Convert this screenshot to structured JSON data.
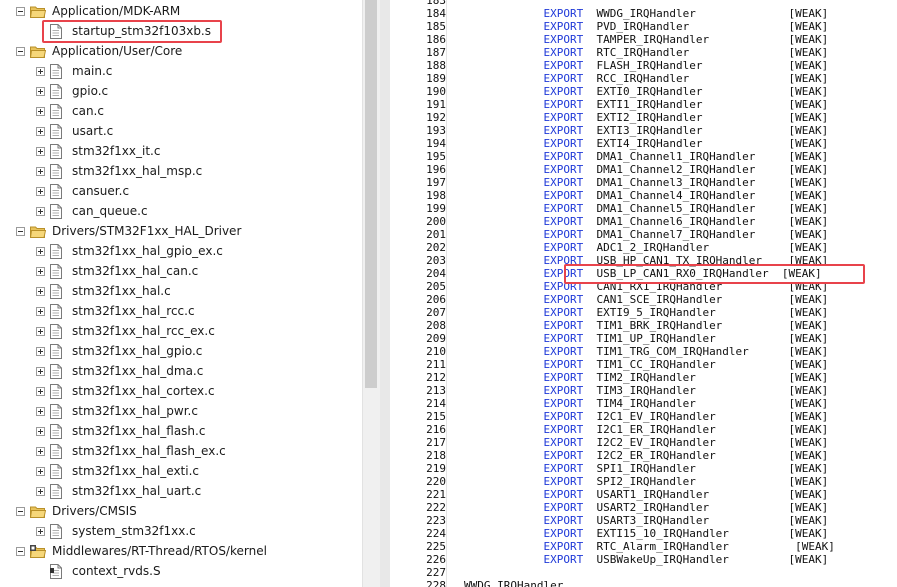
{
  "tree": {
    "items": [
      {
        "kind": "folder",
        "level": 0,
        "expander": "minus",
        "label": "Application/MDK-ARM"
      },
      {
        "kind": "file",
        "level": 1,
        "expander": "none",
        "label": "startup_stm32f103xb.s"
      },
      {
        "kind": "folder",
        "level": 0,
        "expander": "minus",
        "label": "Application/User/Core"
      },
      {
        "kind": "file",
        "level": 1,
        "expander": "plus",
        "label": "main.c"
      },
      {
        "kind": "file",
        "level": 1,
        "expander": "plus",
        "label": "gpio.c"
      },
      {
        "kind": "file",
        "level": 1,
        "expander": "plus",
        "label": "can.c"
      },
      {
        "kind": "file",
        "level": 1,
        "expander": "plus",
        "label": "usart.c"
      },
      {
        "kind": "file",
        "level": 1,
        "expander": "plus",
        "label": "stm32f1xx_it.c"
      },
      {
        "kind": "file",
        "level": 1,
        "expander": "plus",
        "label": "stm32f1xx_hal_msp.c"
      },
      {
        "kind": "file",
        "level": 1,
        "expander": "plus",
        "label": "cansuer.c"
      },
      {
        "kind": "file",
        "level": 1,
        "expander": "plus",
        "label": "can_queue.c"
      },
      {
        "kind": "folder",
        "level": 0,
        "expander": "minus",
        "label": "Drivers/STM32F1xx_HAL_Driver"
      },
      {
        "kind": "file",
        "level": 1,
        "expander": "plus",
        "label": "stm32f1xx_hal_gpio_ex.c"
      },
      {
        "kind": "file",
        "level": 1,
        "expander": "plus",
        "label": "stm32f1xx_hal_can.c"
      },
      {
        "kind": "file",
        "level": 1,
        "expander": "plus",
        "label": "stm32f1xx_hal.c"
      },
      {
        "kind": "file",
        "level": 1,
        "expander": "plus",
        "label": "stm32f1xx_hal_rcc.c"
      },
      {
        "kind": "file",
        "level": 1,
        "expander": "plus",
        "label": "stm32f1xx_hal_rcc_ex.c"
      },
      {
        "kind": "file",
        "level": 1,
        "expander": "plus",
        "label": "stm32f1xx_hal_gpio.c"
      },
      {
        "kind": "file",
        "level": 1,
        "expander": "plus",
        "label": "stm32f1xx_hal_dma.c"
      },
      {
        "kind": "file",
        "level": 1,
        "expander": "plus",
        "label": "stm32f1xx_hal_cortex.c"
      },
      {
        "kind": "file",
        "level": 1,
        "expander": "plus",
        "label": "stm32f1xx_hal_pwr.c"
      },
      {
        "kind": "file",
        "level": 1,
        "expander": "plus",
        "label": "stm32f1xx_hal_flash.c"
      },
      {
        "kind": "file",
        "level": 1,
        "expander": "plus",
        "label": "stm32f1xx_hal_flash_ex.c"
      },
      {
        "kind": "file",
        "level": 1,
        "expander": "plus",
        "label": "stm32f1xx_hal_exti.c"
      },
      {
        "kind": "file",
        "level": 1,
        "expander": "plus",
        "label": "stm32f1xx_hal_uart.c"
      },
      {
        "kind": "folder",
        "level": 0,
        "expander": "minus",
        "label": "Drivers/CMSIS"
      },
      {
        "kind": "file",
        "level": 1,
        "expander": "plus",
        "label": "system_stm32f1xx.c"
      },
      {
        "kind": "folder-special",
        "level": 0,
        "expander": "minus",
        "label": "Middlewares/RT-Thread/RTOS/kernel"
      },
      {
        "kind": "file-special",
        "level": 1,
        "expander": "none",
        "label": "context_rvds.S"
      }
    ]
  },
  "code": {
    "lines": [
      {
        "n": "183",
        "kw": "",
        "text": ""
      },
      {
        "n": "184",
        "kw": "EXPORT",
        "text": "  WWDG_IRQHandler              [WEAK]"
      },
      {
        "n": "185",
        "kw": "EXPORT",
        "text": "  PVD_IRQHandler               [WEAK]"
      },
      {
        "n": "186",
        "kw": "EXPORT",
        "text": "  TAMPER_IRQHandler            [WEAK]"
      },
      {
        "n": "187",
        "kw": "EXPORT",
        "text": "  RTC_IRQHandler               [WEAK]"
      },
      {
        "n": "188",
        "kw": "EXPORT",
        "text": "  FLASH_IRQHandler             [WEAK]"
      },
      {
        "n": "189",
        "kw": "EXPORT",
        "text": "  RCC_IRQHandler               [WEAK]"
      },
      {
        "n": "190",
        "kw": "EXPORT",
        "text": "  EXTI0_IRQHandler             [WEAK]"
      },
      {
        "n": "191",
        "kw": "EXPORT",
        "text": "  EXTI1_IRQHandler             [WEAK]"
      },
      {
        "n": "192",
        "kw": "EXPORT",
        "text": "  EXTI2_IRQHandler             [WEAK]"
      },
      {
        "n": "193",
        "kw": "EXPORT",
        "text": "  EXTI3_IRQHandler             [WEAK]"
      },
      {
        "n": "194",
        "kw": "EXPORT",
        "text": "  EXTI4_IRQHandler             [WEAK]"
      },
      {
        "n": "195",
        "kw": "EXPORT",
        "text": "  DMA1_Channel1_IRQHandler     [WEAK]"
      },
      {
        "n": "196",
        "kw": "EXPORT",
        "text": "  DMA1_Channel2_IRQHandler     [WEAK]"
      },
      {
        "n": "197",
        "kw": "EXPORT",
        "text": "  DMA1_Channel3_IRQHandler     [WEAK]"
      },
      {
        "n": "198",
        "kw": "EXPORT",
        "text": "  DMA1_Channel4_IRQHandler     [WEAK]"
      },
      {
        "n": "199",
        "kw": "EXPORT",
        "text": "  DMA1_Channel5_IRQHandler     [WEAK]"
      },
      {
        "n": "200",
        "kw": "EXPORT",
        "text": "  DMA1_Channel6_IRQHandler     [WEAK]"
      },
      {
        "n": "201",
        "kw": "EXPORT",
        "text": "  DMA1_Channel7_IRQHandler     [WEAK]"
      },
      {
        "n": "202",
        "kw": "EXPORT",
        "text": "  ADC1_2_IRQHandler            [WEAK]"
      },
      {
        "n": "203",
        "kw": "EXPORT",
        "text": "  USB_HP_CAN1_TX_IRQHandler    [WEAK]"
      },
      {
        "n": "204",
        "kw": "EXPORT",
        "text": "  USB_LP_CAN1_RX0_IRQHandler  [WEAK]"
      },
      {
        "n": "205",
        "kw": "EXPORT",
        "text": "  CAN1_RX1_IRQHandler          [WEAK]"
      },
      {
        "n": "206",
        "kw": "EXPORT",
        "text": "  CAN1_SCE_IRQHandler          [WEAK]"
      },
      {
        "n": "207",
        "kw": "EXPORT",
        "text": "  EXTI9_5_IRQHandler           [WEAK]"
      },
      {
        "n": "208",
        "kw": "EXPORT",
        "text": "  TIM1_BRK_IRQHandler          [WEAK]"
      },
      {
        "n": "209",
        "kw": "EXPORT",
        "text": "  TIM1_UP_IRQHandler           [WEAK]"
      },
      {
        "n": "210",
        "kw": "EXPORT",
        "text": "  TIM1_TRG_COM_IRQHandler      [WEAK]"
      },
      {
        "n": "211",
        "kw": "EXPORT",
        "text": "  TIM1_CC_IRQHandler           [WEAK]"
      },
      {
        "n": "212",
        "kw": "EXPORT",
        "text": "  TIM2_IRQHandler              [WEAK]"
      },
      {
        "n": "213",
        "kw": "EXPORT",
        "text": "  TIM3_IRQHandler              [WEAK]"
      },
      {
        "n": "214",
        "kw": "EXPORT",
        "text": "  TIM4_IRQHandler              [WEAK]"
      },
      {
        "n": "215",
        "kw": "EXPORT",
        "text": "  I2C1_EV_IRQHandler           [WEAK]"
      },
      {
        "n": "216",
        "kw": "EXPORT",
        "text": "  I2C1_ER_IRQHandler           [WEAK]"
      },
      {
        "n": "217",
        "kw": "EXPORT",
        "text": "  I2C2_EV_IRQHandler           [WEAK]"
      },
      {
        "n": "218",
        "kw": "EXPORT",
        "text": "  I2C2_ER_IRQHandler           [WEAK]"
      },
      {
        "n": "219",
        "kw": "EXPORT",
        "text": "  SPI1_IRQHandler              [WEAK]"
      },
      {
        "n": "220",
        "kw": "EXPORT",
        "text": "  SPI2_IRQHandler              [WEAK]"
      },
      {
        "n": "221",
        "kw": "EXPORT",
        "text": "  USART1_IRQHandler            [WEAK]"
      },
      {
        "n": "222",
        "kw": "EXPORT",
        "text": "  USART2_IRQHandler            [WEAK]"
      },
      {
        "n": "223",
        "kw": "EXPORT",
        "text": "  USART3_IRQHandler            [WEAK]"
      },
      {
        "n": "224",
        "kw": "EXPORT",
        "text": "  EXTI15_10_IRQHandler         [WEAK]"
      },
      {
        "n": "225",
        "kw": "EXPORT",
        "text": "  RTC_Alarm_IRQHandler          [WEAK]"
      },
      {
        "n": "226",
        "kw": "EXPORT",
        "text": "  USBWakeUp_IRQHandler         [WEAK]"
      },
      {
        "n": "227",
        "kw": "",
        "text": ""
      },
      {
        "n": "228",
        "kw": "",
        "text": "WWDG_IRQHandler"
      }
    ]
  },
  "colors": {
    "keyword": "#1f39d8",
    "highlight": "#e8434b"
  }
}
